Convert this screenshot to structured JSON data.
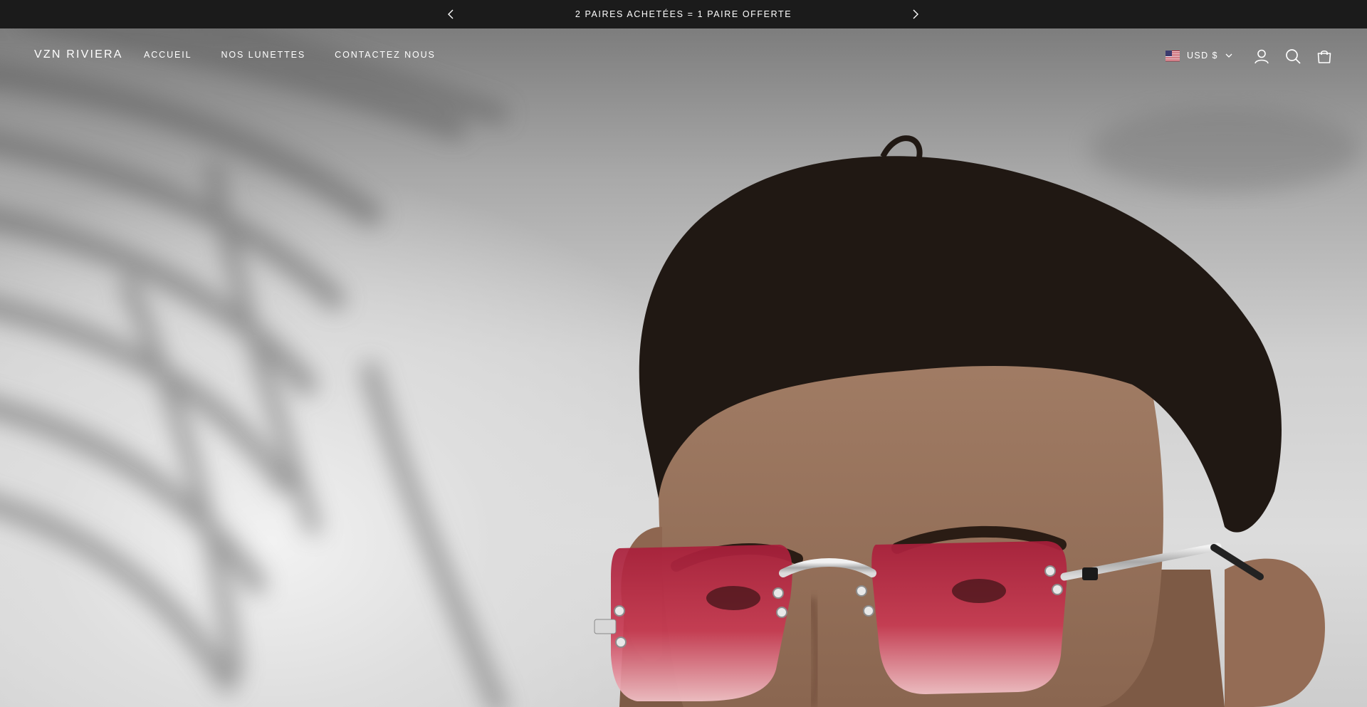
{
  "announcement": {
    "message": "2 PAIRES ACHETÉES = 1 PAIRE OFFERTE",
    "prev_icon": "chevron-left-icon",
    "next_icon": "chevron-right-icon"
  },
  "header": {
    "logo": "VZN RIVIERA",
    "nav": [
      {
        "label": "ACCUEIL"
      },
      {
        "label": "NOS LUNETTES"
      },
      {
        "label": "CONTACTEZ NOUS"
      }
    ],
    "currency": {
      "label": "USD $",
      "flag_icon": "us-flag-icon",
      "dropdown_icon": "chevron-down-icon"
    },
    "icons": [
      "account-icon",
      "search-icon",
      "cart-icon"
    ]
  },
  "hero": {
    "image": "man-wearing-red-tinted-rimless-sunglasses",
    "colors": {
      "lens": "#c7394f",
      "background": "#d6d6d6",
      "bar": "#1b1b1b"
    }
  }
}
